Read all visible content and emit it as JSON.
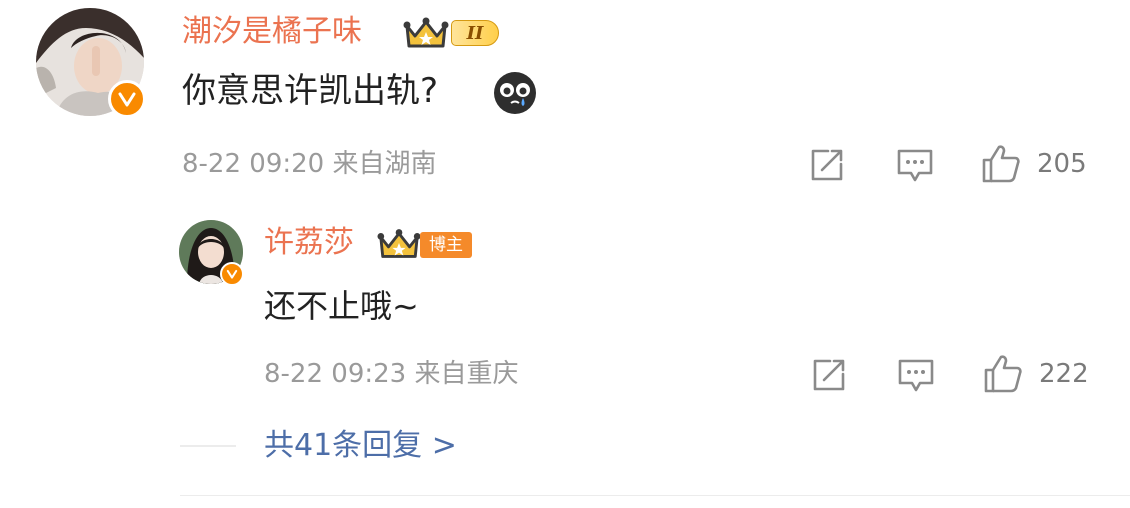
{
  "colors": {
    "name": "#eb7350",
    "content": "#222222",
    "meta": "#9a9a9a",
    "link": "#4d6ea8",
    "badge_orange": "#f98a00"
  },
  "main_comment": {
    "username": "潮汐是橘子味",
    "level_badge": "II",
    "text": "你意思许凯出轨?",
    "emoji": "crying-face-emoji",
    "timestamp": "8-22 09:20 来自湖南",
    "like_count": "205",
    "icons": [
      "repost-icon",
      "comment-icon",
      "like-icon"
    ]
  },
  "reply": {
    "username": "许荔莎",
    "role_badge": "博主",
    "text": "还不止哦~",
    "timestamp": "8-22 09:23 来自重庆",
    "like_count": "222",
    "icons": [
      "repost-icon",
      "comment-icon",
      "like-icon"
    ]
  },
  "more_replies": {
    "label": "共41条回复 >"
  }
}
